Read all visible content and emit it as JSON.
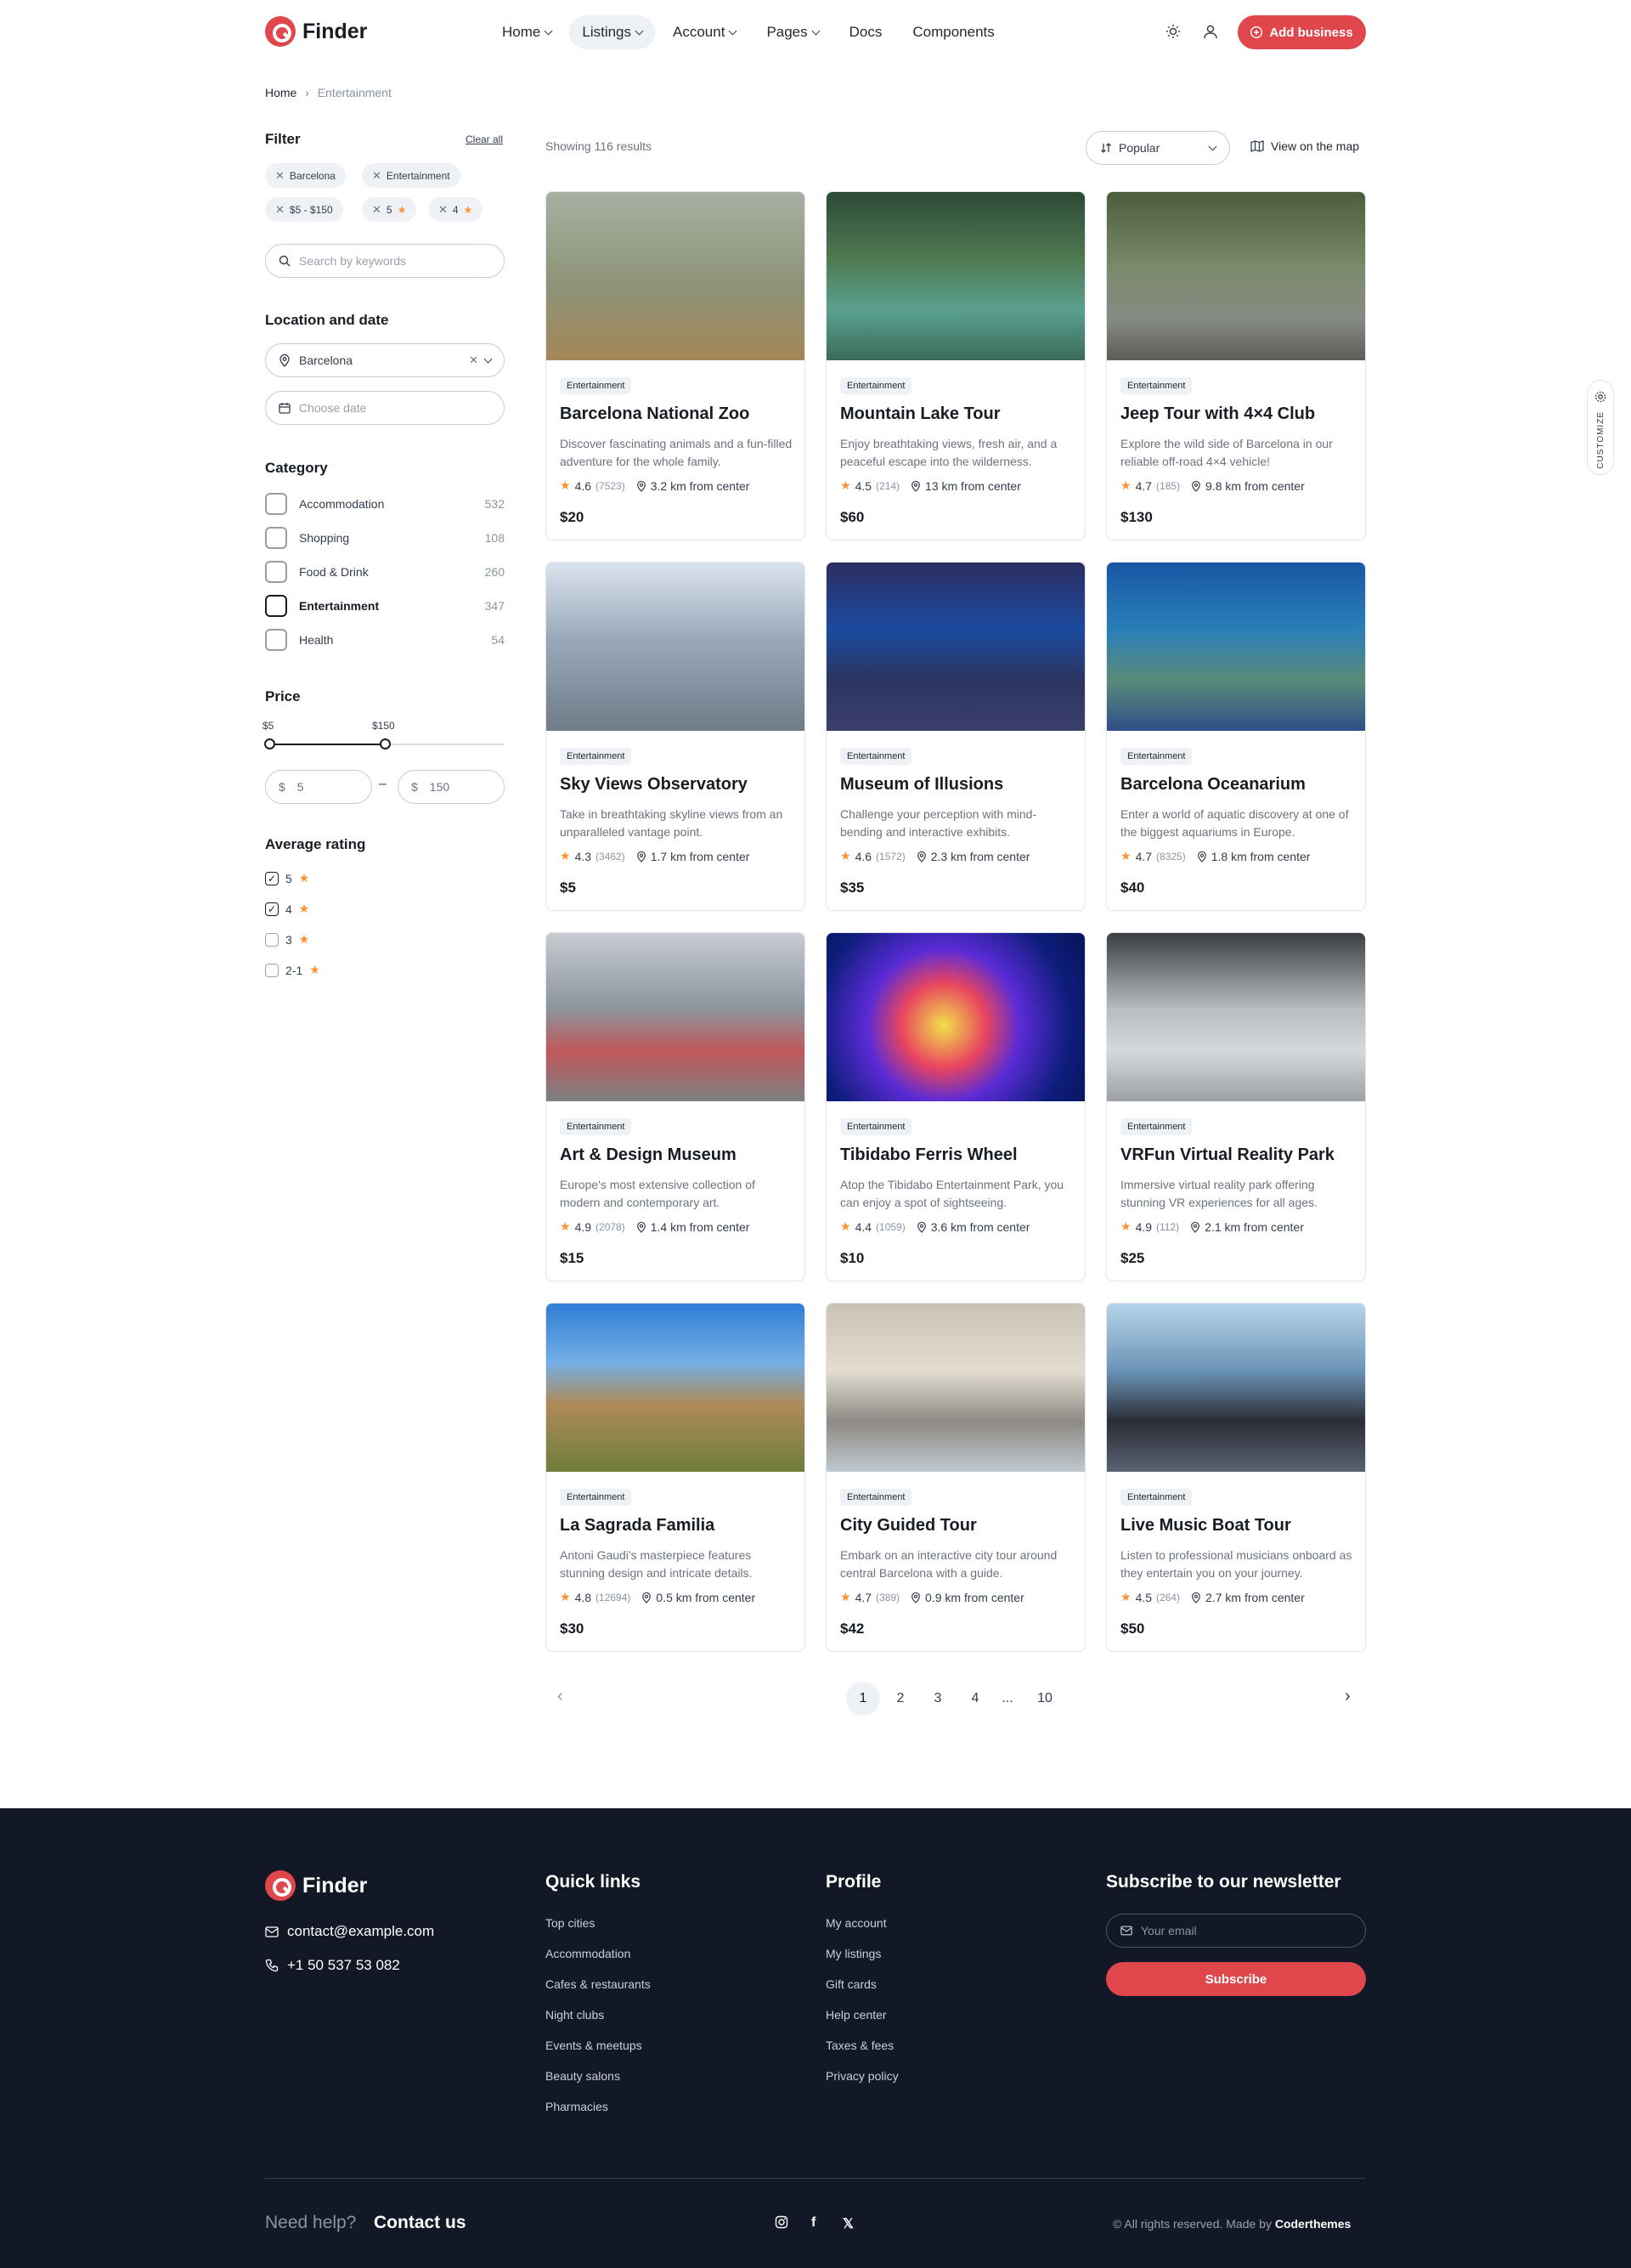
{
  "brand": {
    "name": "Finder",
    "accent": "#e0474c"
  },
  "nav": {
    "items": [
      "Home",
      "Listings",
      "Account",
      "Pages",
      "Docs",
      "Components"
    ],
    "add_business": "Add business"
  },
  "breadcrumb": {
    "home": "Home",
    "current": "Entertainment"
  },
  "filter": {
    "title": "Filter",
    "clear_all": "Clear all",
    "chips": [
      "Barcelona",
      "Entertainment",
      "$5 - $150",
      "5",
      "4"
    ],
    "search_placeholder": "Search by keywords",
    "location_title": "Location and date",
    "location_value": "Barcelona",
    "date_placeholder": "Choose date",
    "category_title": "Category",
    "categories": [
      {
        "label": "Accommodation",
        "count": "532"
      },
      {
        "label": "Shopping",
        "count": "108"
      },
      {
        "label": "Food & Drink",
        "count": "260"
      },
      {
        "label": "Entertainment",
        "count": "347"
      },
      {
        "label": "Health",
        "count": "54"
      }
    ],
    "price_title": "Price",
    "price_min_label": "$5",
    "price_max_label": "$150",
    "price_min": "5",
    "price_max": "150",
    "currency": "$",
    "rating_title": "Average rating",
    "ratings": [
      {
        "label": "5",
        "checked": true
      },
      {
        "label": "4",
        "checked": true
      },
      {
        "label": "3",
        "checked": false
      },
      {
        "label": "2-1",
        "checked": false
      }
    ]
  },
  "results": {
    "showing": "Showing 116 results",
    "sort": "Popular",
    "map": "View on the map"
  },
  "cards": [
    {
      "badge": "Entertainment",
      "title": "Barcelona National Zoo",
      "desc": "Discover fascinating animals and a fun-filled adventure for the whole family.",
      "rating": "4.6",
      "reviews": "(7523)",
      "distance": "3.2 km from center",
      "price": "$20"
    },
    {
      "badge": "Entertainment",
      "title": "Mountain Lake Tour",
      "desc": "Enjoy breathtaking views, fresh air, and a peaceful escape into the wilderness.",
      "rating": "4.5",
      "reviews": "(214)",
      "distance": "13 km from center",
      "price": "$60"
    },
    {
      "badge": "Entertainment",
      "title": "Jeep Tour with 4×4 Club",
      "desc": "Explore the wild side of Barcelona in our reliable off-road 4×4 vehicle!",
      "rating": "4.7",
      "reviews": "(185)",
      "distance": "9.8 km from center",
      "price": "$130"
    },
    {
      "badge": "Entertainment",
      "title": "Sky Views Observatory",
      "desc": "Take in breathtaking skyline views from an unparalleled vantage point.",
      "rating": "4.3",
      "reviews": "(3462)",
      "distance": "1.7 km from center",
      "price": "$5"
    },
    {
      "badge": "Entertainment",
      "title": "Museum of Illusions",
      "desc": "Challenge your perception with mind-bending and interactive exhibits.",
      "rating": "4.6",
      "reviews": "(1572)",
      "distance": "2.3 km from center",
      "price": "$35"
    },
    {
      "badge": "Entertainment",
      "title": "Barcelona Oceanarium",
      "desc": "Enter a world of aquatic discovery at one of the biggest aquariums in Europe.",
      "rating": "4.7",
      "reviews": "(8325)",
      "distance": "1.8 km from center",
      "price": "$40"
    },
    {
      "badge": "Entertainment",
      "title": "Art & Design Museum",
      "desc": "Europe's most extensive collection of modern and contemporary art.",
      "rating": "4.9",
      "reviews": "(2078)",
      "distance": "1.4 km from center",
      "price": "$15"
    },
    {
      "badge": "Entertainment",
      "title": "Tibidabo Ferris Wheel",
      "desc": "Atop the Tibidabo Entertainment Park, you can enjoy a spot of sightseeing.",
      "rating": "4.4",
      "reviews": "(1059)",
      "distance": "3.6 km from center",
      "price": "$10"
    },
    {
      "badge": "Entertainment",
      "title": "VRFun Virtual Reality Park",
      "desc": "Immersive virtual reality park offering stunning VR experiences for all ages.",
      "rating": "4.9",
      "reviews": "(112)",
      "distance": "2.1 km from center",
      "price": "$25"
    },
    {
      "badge": "Entertainment",
      "title": "La Sagrada Familia",
      "desc": "Antoni Gaudi's masterpiece features stunning design and intricate details.",
      "rating": "4.8",
      "reviews": "(12694)",
      "distance": "0.5 km from center",
      "price": "$30"
    },
    {
      "badge": "Entertainment",
      "title": "City Guided Tour",
      "desc": "Embark on an interactive city tour around central Barcelona with a guide.",
      "rating": "4.7",
      "reviews": "(389)",
      "distance": "0.9 km from center",
      "price": "$42"
    },
    {
      "badge": "Entertainment",
      "title": "Live Music Boat Tour",
      "desc": "Listen to professional musicians onboard as they entertain you on your journey.",
      "rating": "4.5",
      "reviews": "(264)",
      "distance": "2.7 km from center",
      "price": "$50"
    }
  ],
  "pagination": {
    "pages": [
      "1",
      "2",
      "3",
      "4",
      "...",
      "10"
    ],
    "current": "1"
  },
  "customize": "CUSTOMIZE",
  "footer": {
    "email": "contact@example.com",
    "phone": "+1 50 537 53 082",
    "quick_title": "Quick links",
    "quick": [
      "Top cities",
      "Accommodation",
      "Cafes & restaurants",
      "Night clubs",
      "Events & meetups",
      "Beauty salons",
      "Pharmacies"
    ],
    "profile_title": "Profile",
    "profile": [
      "My account",
      "My listings",
      "Gift cards",
      "Help center",
      "Taxes & fees",
      "Privacy policy"
    ],
    "newsletter_title": "Subscribe to our newsletter",
    "email_placeholder": "Your email",
    "subscribe": "Subscribe",
    "need_help": "Need help?",
    "contact_us": "Contact us",
    "copyright": "© All rights reserved. Made by",
    "made_by": "Coderthemes"
  }
}
